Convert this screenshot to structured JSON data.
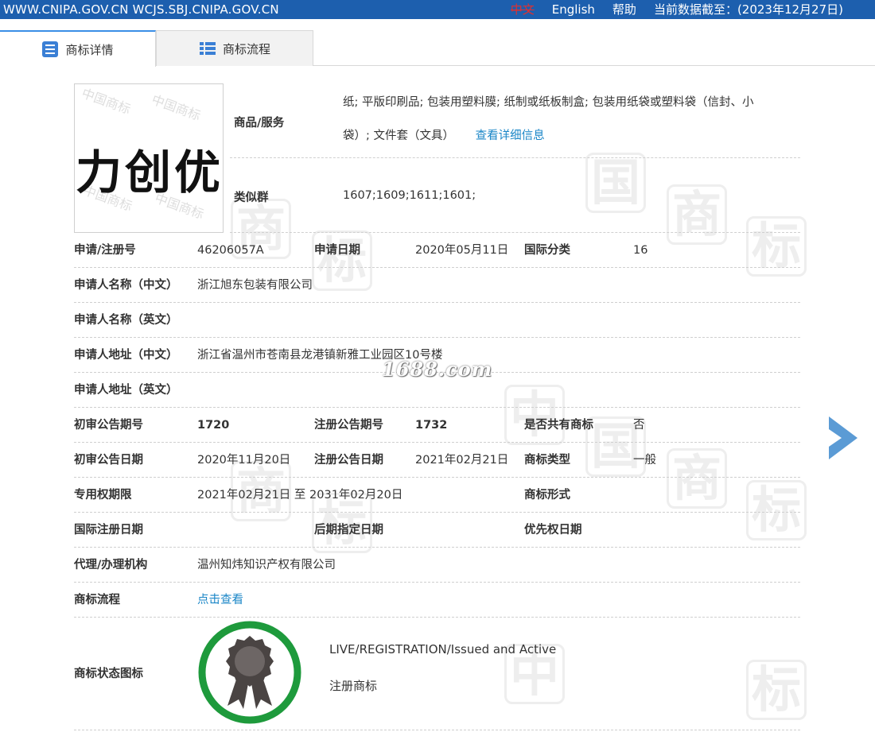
{
  "topbar": {
    "site": "WWW.CNIPA.GOV.CN WCJS.SBJ.CNIPA.GOV.CN",
    "lang_zh": "中文",
    "lang_en": "English",
    "help": "帮助",
    "data_date": "当前数据截至：(2023年12月27日)"
  },
  "tabs": {
    "detail": "商标详情",
    "flow": "商标流程"
  },
  "trademark": {
    "mark_text": "力创优",
    "watermark_text": "中国商标"
  },
  "goods": {
    "label": "商品/服务",
    "line1": "纸; 平版印刷品; 包装用塑料膜; 纸制或纸板制盒; 包装用纸袋或塑料袋（信封、小",
    "line2": "袋）; 文件套（文具）",
    "detail_link": "查看详细信息"
  },
  "similar_group": {
    "label": "类似群",
    "value": "1607;1609;1611;1601;"
  },
  "fields": {
    "reg_no_label": "申请/注册号",
    "reg_no": "46206057A",
    "app_date_label": "申请日期",
    "app_date": "2020年05月11日",
    "intl_class_label": "国际分类",
    "intl_class": "16",
    "applicant_cn_label": "申请人名称（中文）",
    "applicant_cn": "浙江旭东包装有限公司",
    "applicant_en_label": "申请人名称（英文）",
    "applicant_en": "",
    "address_cn_label": "申请人地址（中文）",
    "address_cn": "浙江省温州市苍南县龙港镇新雅工业园区10号楼",
    "address_en_label": "申请人地址（英文）",
    "address_en": "",
    "prelim_no_label": "初审公告期号",
    "prelim_no": "1720",
    "reg_pub_no_label": "注册公告期号",
    "reg_pub_no": "1732",
    "shared_label": "是否共有商标",
    "shared": "否",
    "prelim_date_label": "初审公告日期",
    "prelim_date": "2020年11月20日",
    "reg_pub_date_label": "注册公告日期",
    "reg_pub_date": "2021年02月21日",
    "mark_type_label": "商标类型",
    "mark_type": "一般",
    "exclusive_label": "专用权期限",
    "exclusive": "2021年02月21日 至 2031年02月20日",
    "mark_form_label": "商标形式",
    "mark_form": "",
    "intl_reg_date_label": "国际注册日期",
    "intl_reg_date": "",
    "later_designation_label": "后期指定日期",
    "later_designation": "",
    "priority_date_label": "优先权日期",
    "priority_date": "",
    "agent_label": "代理/办理机构",
    "agent": "温州知炜知识产权有限公司",
    "flow_label": "商标流程",
    "flow_link": "点击查看",
    "status_label": "商标状态图标",
    "status_en": "LIVE/REGISTRATION/Issued and Active",
    "status_zh": "注册商标"
  },
  "overlay_watermark": "1688.com",
  "colors": {
    "topbar": "#1d5fae",
    "link": "#1a86c7",
    "seal_ring": "#1e9a3c",
    "arrow": "#5b9bd5"
  },
  "icons": {
    "detail_tab": "document-list-icon",
    "flow_tab": "list-grid-icon",
    "next": "chevron-right-icon",
    "status": "award-ribbon-icon"
  }
}
